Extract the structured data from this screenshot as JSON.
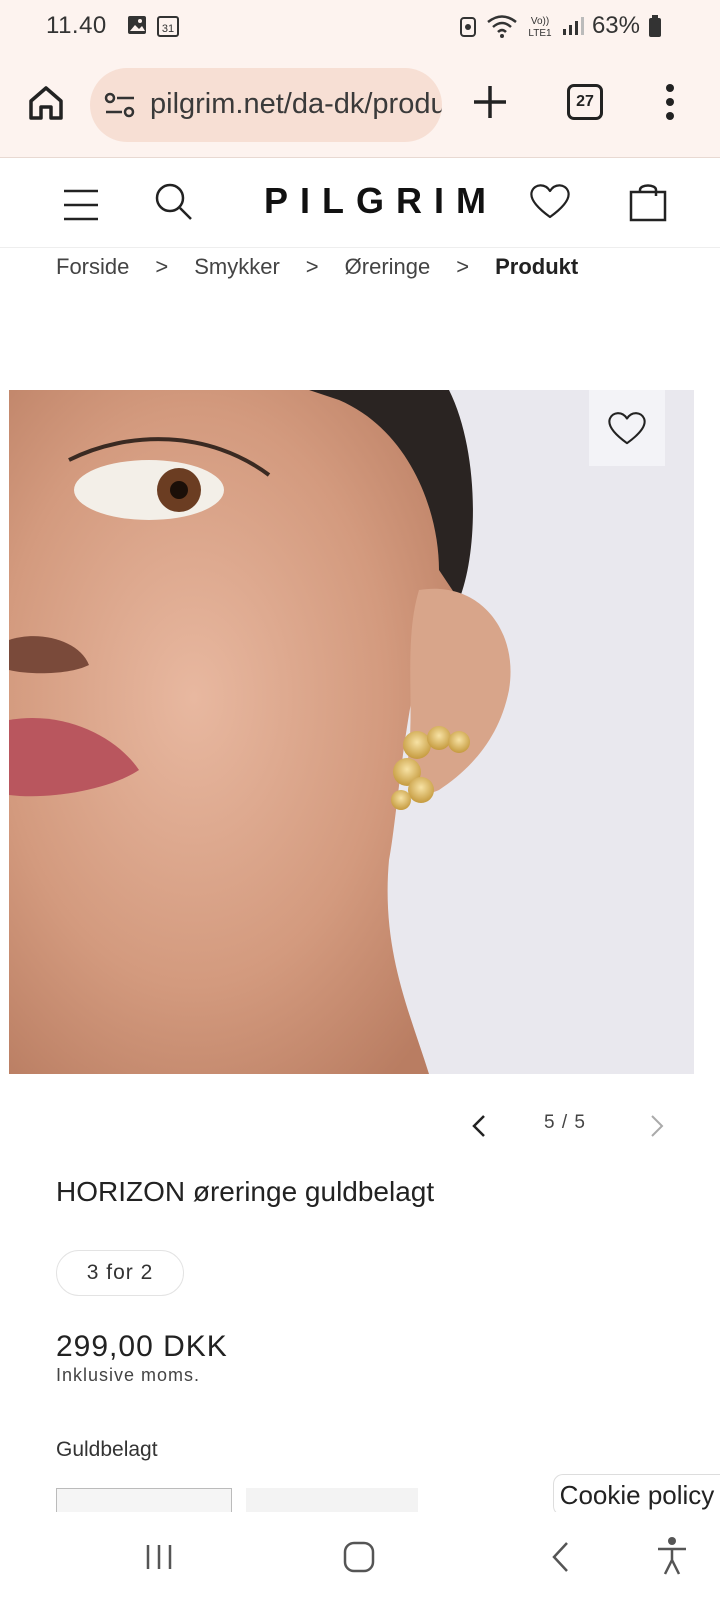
{
  "status_bar": {
    "time": "11.40",
    "battery": "63%",
    "icons": [
      "gallery-icon",
      "calendar-icon",
      "recycle-icon",
      "wifi-icon",
      "volte-icon",
      "signal-icon",
      "battery-icon"
    ],
    "calendar_day": "31",
    "network": "Vo) LTE1"
  },
  "browser": {
    "url": "pilgrim.net/da-dk/products",
    "tab_count": "27"
  },
  "site": {
    "logo": "PILGRIM"
  },
  "breadcrumb": {
    "items": [
      "Forside",
      "Smykker",
      "Øreringe"
    ],
    "current": "Produkt",
    "separator": ">"
  },
  "gallery": {
    "counter": "5 / 5",
    "current": 5,
    "total": 5
  },
  "product": {
    "title": "HORIZON øreringe guldbelagt",
    "promo": "3 for 2",
    "price": "299,00 DKK",
    "tax_note": "Inklusive moms.",
    "variant_label": "Guldbelagt"
  },
  "cookie": {
    "label": "Cookie policy"
  },
  "colors": {
    "browser_bg": "#fdf3ef",
    "url_bg": "#f7dfd4",
    "text": "#222222"
  }
}
